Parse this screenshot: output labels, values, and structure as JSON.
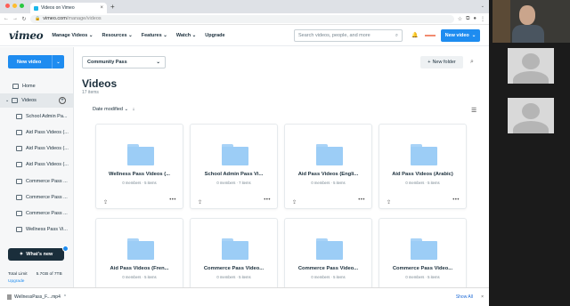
{
  "browser": {
    "tab_title": "Videos on Vimeo",
    "url_host": "vimeo.com",
    "url_path": "/manage/videos"
  },
  "header": {
    "logo": "vimeo",
    "menu": [
      "Manage Videos",
      "Resources",
      "Features",
      "Watch",
      "Upgrade"
    ],
    "search_placeholder": "Search videos, people, and more",
    "new_video_label": "New video"
  },
  "sidebar": {
    "new_video_label": "New video",
    "items": [
      {
        "label": "Home"
      },
      {
        "label": "Videos"
      },
      {
        "label": "School Admin Pa..."
      },
      {
        "label": "Aid Pass Videos (..."
      },
      {
        "label": "Aid Pass Videos (..."
      },
      {
        "label": "Aid Pass Videos (..."
      },
      {
        "label": "Commerce Pass ..."
      },
      {
        "label": "Commerce Pass ..."
      },
      {
        "label": "Commerce Pass ..."
      },
      {
        "label": "Wellness Pass Vi..."
      }
    ],
    "whats_new": "What's new",
    "storage_label": "Total Limit",
    "storage_value": "5.7GB of 7TB",
    "upgrade": "Upgrade"
  },
  "main": {
    "team_selector": "Community Pass",
    "new_folder": "New folder",
    "title": "Videos",
    "count": "17 items",
    "sort_label": "Date modified",
    "folders": [
      {
        "title": "Wellness Pass Videos (...",
        "meta": "0 members · 5 items"
      },
      {
        "title": "School Admin Pass Vi...",
        "meta": "0 members · 7 items"
      },
      {
        "title": "Aid Pass Videos (Engli...",
        "meta": "0 members · 5 items"
      },
      {
        "title": "Aid Pass Videos (Arabic)",
        "meta": "0 members · 5 items"
      },
      {
        "title": "Aid Pass Videos (Fren...",
        "meta": "0 members · 5 items"
      },
      {
        "title": "Commerce Pass Video...",
        "meta": "0 members · 5 items"
      },
      {
        "title": "Commerce Pass Video...",
        "meta": "0 members · 5 items"
      },
      {
        "title": "Commerce Pass Video...",
        "meta": "0 members · 5 items"
      }
    ]
  },
  "downloads": {
    "file": "WellnessPass_F....mp4",
    "show_all": "Show All"
  }
}
